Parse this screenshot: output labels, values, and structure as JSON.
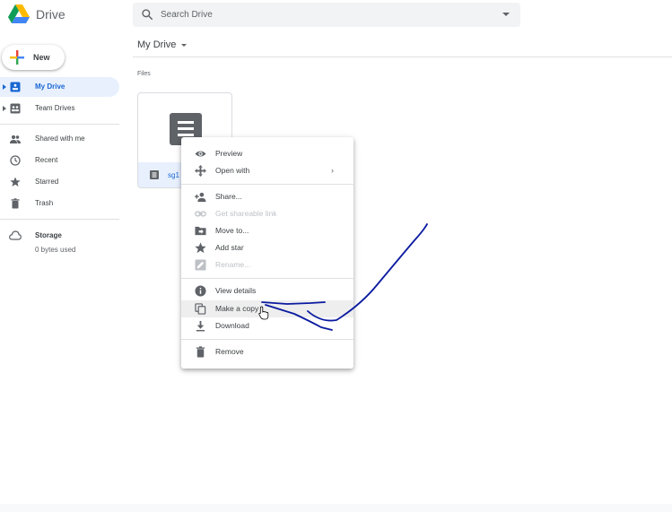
{
  "header": {
    "brand": "Drive",
    "search_placeholder": "Search Drive"
  },
  "sidebar": {
    "new_label": "New",
    "items": [
      {
        "label": "My Drive",
        "icon": "my-drive-icon",
        "active": true,
        "expandable": true
      },
      {
        "label": "Team Drives",
        "icon": "team-drives-icon",
        "active": false,
        "expandable": true
      },
      {
        "label": "Shared with me",
        "icon": "people-icon",
        "active": false
      },
      {
        "label": "Recent",
        "icon": "clock-icon",
        "active": false
      },
      {
        "label": "Starred",
        "icon": "star-icon",
        "active": false
      },
      {
        "label": "Trash",
        "icon": "trash-icon",
        "active": false
      }
    ],
    "storage_label": "Storage",
    "storage_value": "0 bytes used"
  },
  "main": {
    "breadcrumb": "My Drive",
    "section_label": "Files",
    "file": {
      "name": "sg1",
      "icon": "google-forms-icon"
    }
  },
  "context_menu": {
    "items": [
      {
        "label": "Preview",
        "icon": "eye-icon",
        "disabled": false
      },
      {
        "label": "Open with",
        "icon": "open-with-icon",
        "disabled": false,
        "submenu": true
      },
      {
        "label": "Share...",
        "icon": "person-add-icon",
        "disabled": false
      },
      {
        "label": "Get shareable link",
        "icon": "link-icon",
        "disabled": true
      },
      {
        "label": "Move to...",
        "icon": "folder-move-icon",
        "disabled": false
      },
      {
        "label": "Add star",
        "icon": "star-icon",
        "disabled": false
      },
      {
        "label": "Rename...",
        "icon": "edit-icon",
        "disabled": true
      },
      {
        "label": "View details",
        "icon": "info-icon",
        "disabled": false
      },
      {
        "label": "Make a copy",
        "icon": "copy-icon",
        "disabled": false,
        "hovered": true
      },
      {
        "label": "Download",
        "icon": "download-icon",
        "disabled": false
      },
      {
        "label": "Remove",
        "icon": "trash-icon",
        "disabled": false
      }
    ],
    "submenu_glyph": "›"
  },
  "colors": {
    "accent": "#1967d2",
    "active_bg": "#e8f0fe",
    "annotation_ink": "#0a1aa0"
  }
}
